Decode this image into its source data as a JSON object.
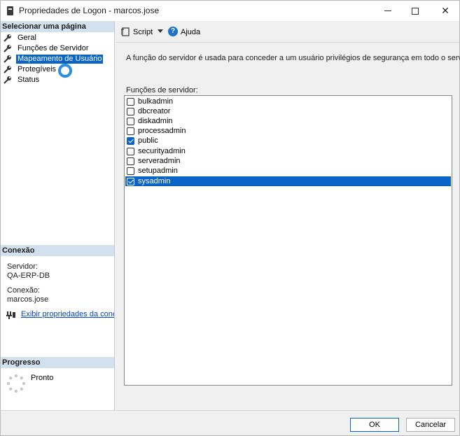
{
  "window": {
    "title": "Propriedades de Logon - marcos.jose",
    "minimize_icon": "minimize-icon",
    "maximize_icon": "maximize-icon",
    "close_icon": "close-icon",
    "close_glyph": "✕"
  },
  "sidebar": {
    "select_page_header": "Selecionar uma página",
    "items": [
      {
        "label": "Geral",
        "icon": "wrench-icon"
      },
      {
        "label": "Funções de Servidor",
        "icon": "wrench-icon"
      },
      {
        "label": "Mapeamento de Usuário",
        "icon": "wrench-icon",
        "selected": true
      },
      {
        "label": "Protegíveis",
        "icon": "wrench-icon"
      },
      {
        "label": "Status",
        "icon": "wrench-icon"
      }
    ],
    "connection_header": "Conexão",
    "server_label": "Servidor:",
    "server_value": "QA-ERP-DB",
    "connection_label": "Conexão:",
    "connection_value": "marcos.jose",
    "view_connection_link": "Exibir propriedades da conexão",
    "progress_header": "Progresso",
    "progress_status": "Pronto"
  },
  "toolbar": {
    "script_label": "Script",
    "help_label": "Ajuda",
    "help_glyph": "?"
  },
  "main": {
    "description": "A função do servidor é usada para conceder a um usuário privilégios de segurança em todo o servidor.",
    "roles_label": "Funções de servidor:",
    "roles": [
      {
        "name": "bulkadmin",
        "checked": false
      },
      {
        "name": "dbcreator",
        "checked": false
      },
      {
        "name": "diskadmin",
        "checked": false
      },
      {
        "name": "processadmin",
        "checked": false
      },
      {
        "name": "public",
        "checked": true
      },
      {
        "name": "securityadmin",
        "checked": false
      },
      {
        "name": "serveradmin",
        "checked": false
      },
      {
        "name": "setupadmin",
        "checked": false
      },
      {
        "name": "sysadmin",
        "checked": true,
        "selected": true
      }
    ]
  },
  "buttons": {
    "ok": "OK",
    "cancel": "Cancelar"
  },
  "colors": {
    "accent": "#0a64c8",
    "section_header_bg": "#d3e1ee",
    "link": "#0645c8"
  }
}
